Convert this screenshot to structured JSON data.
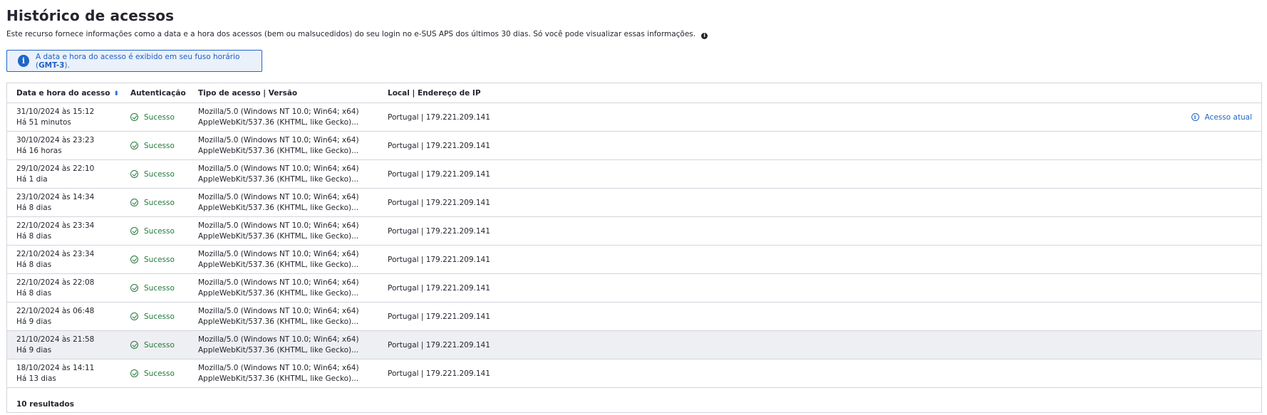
{
  "page": {
    "title": "Histórico de acessos",
    "subtitle": "Este recurso fornece informações como a data e a hora dos acessos (bem ou malsucedidos) do seu login no e-SUS APS dos últimos 30 dias. Só você pode visualizar essas informações.",
    "subtitle_icon": "info-icon"
  },
  "alert": {
    "text_before": "A data e hora do acesso é exibido em seu fuso horário (",
    "timezone": "GMT-3",
    "text_after": ").",
    "icon": "info-icon"
  },
  "table": {
    "headers": {
      "date": "Data e hora do acesso",
      "auth": "Autenticação",
      "type": "Tipo de acesso | Versão",
      "local": "Local | Endereço de IP"
    },
    "rows": [
      {
        "date": "31/10/2024 às 15:12",
        "ago": "Há 51 minutos",
        "auth": "Sucesso",
        "type1": "Mozilla/5.0 (Windows NT 10.0; Win64; x64)",
        "type2": "AppleWebKit/537.36 (KHTML, like Gecko)...",
        "local": "Portugal | 179.221.209.141",
        "current": "Acesso atual"
      },
      {
        "date": "30/10/2024 às 23:23",
        "ago": "Há 16 horas",
        "auth": "Sucesso",
        "type1": "Mozilla/5.0 (Windows NT 10.0; Win64; x64)",
        "type2": "AppleWebKit/537.36 (KHTML, like Gecko)...",
        "local": "Portugal | 179.221.209.141"
      },
      {
        "date": "29/10/2024 às 22:10",
        "ago": "Há 1 dia",
        "auth": "Sucesso",
        "type1": "Mozilla/5.0 (Windows NT 10.0; Win64; x64)",
        "type2": "AppleWebKit/537.36 (KHTML, like Gecko)...",
        "local": "Portugal | 179.221.209.141"
      },
      {
        "date": "23/10/2024 às 14:34",
        "ago": "Há 8 dias",
        "auth": "Sucesso",
        "type1": "Mozilla/5.0 (Windows NT 10.0; Win64; x64)",
        "type2": "AppleWebKit/537.36 (KHTML, like Gecko)...",
        "local": "Portugal | 179.221.209.141"
      },
      {
        "date": "22/10/2024 às 23:34",
        "ago": "Há 8 dias",
        "auth": "Sucesso",
        "type1": "Mozilla/5.0 (Windows NT 10.0; Win64; x64)",
        "type2": "AppleWebKit/537.36 (KHTML, like Gecko)...",
        "local": "Portugal | 179.221.209.141"
      },
      {
        "date": "22/10/2024 às 23:34",
        "ago": "Há 8 dias",
        "auth": "Sucesso",
        "type1": "Mozilla/5.0 (Windows NT 10.0; Win64; x64)",
        "type2": "AppleWebKit/537.36 (KHTML, like Gecko)...",
        "local": "Portugal | 179.221.209.141"
      },
      {
        "date": "22/10/2024 às 22:08",
        "ago": "Há 8 dias",
        "auth": "Sucesso",
        "type1": "Mozilla/5.0 (Windows NT 10.0; Win64; x64)",
        "type2": "AppleWebKit/537.36 (KHTML, like Gecko)...",
        "local": "Portugal | 179.221.209.141"
      },
      {
        "date": "22/10/2024 às 06:48",
        "ago": "Há 9 dias",
        "auth": "Sucesso",
        "type1": "Mozilla/5.0 (Windows NT 10.0; Win64; x64)",
        "type2": "AppleWebKit/537.36 (KHTML, like Gecko)...",
        "local": "Portugal | 179.221.209.141"
      },
      {
        "date": "21/10/2024 às 21:58",
        "ago": "Há 9 dias",
        "auth": "Sucesso",
        "type1": "Mozilla/5.0 (Windows NT 10.0; Win64; x64)",
        "type2": "AppleWebKit/537.36 (KHTML, like Gecko)...",
        "local": "Portugal | 179.221.209.141"
      },
      {
        "date": "18/10/2024 às 14:11",
        "ago": "Há 13 dias",
        "auth": "Sucesso",
        "type1": "Mozilla/5.0 (Windows NT 10.0; Win64; x64)",
        "type2": "AppleWebKit/537.36 (KHTML, like Gecko)...",
        "local": "Portugal | 179.221.209.141"
      }
    ],
    "footer": "10 resultados"
  },
  "colors": {
    "success": "#247a3c",
    "accent": "#1f66c8",
    "highlight_row": "#eeeff3"
  }
}
